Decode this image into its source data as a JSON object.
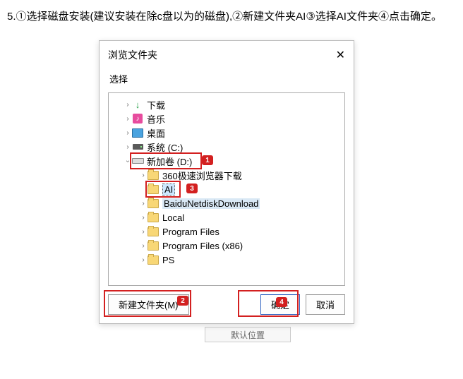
{
  "instruction": "5.①选择磁盘安装(建议安装在除c盘以为的磁盘),②新建文件夹AI③选择AI文件夹④点击确定。",
  "dialog": {
    "title": "浏览文件夹",
    "subtitle": "选择",
    "close": "✕"
  },
  "tree": {
    "downloads": "下载",
    "music": "音乐",
    "desktop": "桌面",
    "sys_c": "系统 (C:)",
    "drive_d": "新加卷 (D:)",
    "d_360": "360极速浏览器下载",
    "d_ai": "AI",
    "d_baidu": "BaiduNetdiskDownload",
    "d_local": "Local",
    "d_pf": "Program Files",
    "d_pf86": "Program Files (x86)",
    "d_ps": "PS"
  },
  "buttons": {
    "new_folder": "新建文件夹(M)",
    "ok": "确定",
    "cancel": "取消"
  },
  "badges": {
    "b1": "1",
    "b2": "2",
    "b3": "3",
    "b4": "4"
  },
  "ghost": "默认位置"
}
